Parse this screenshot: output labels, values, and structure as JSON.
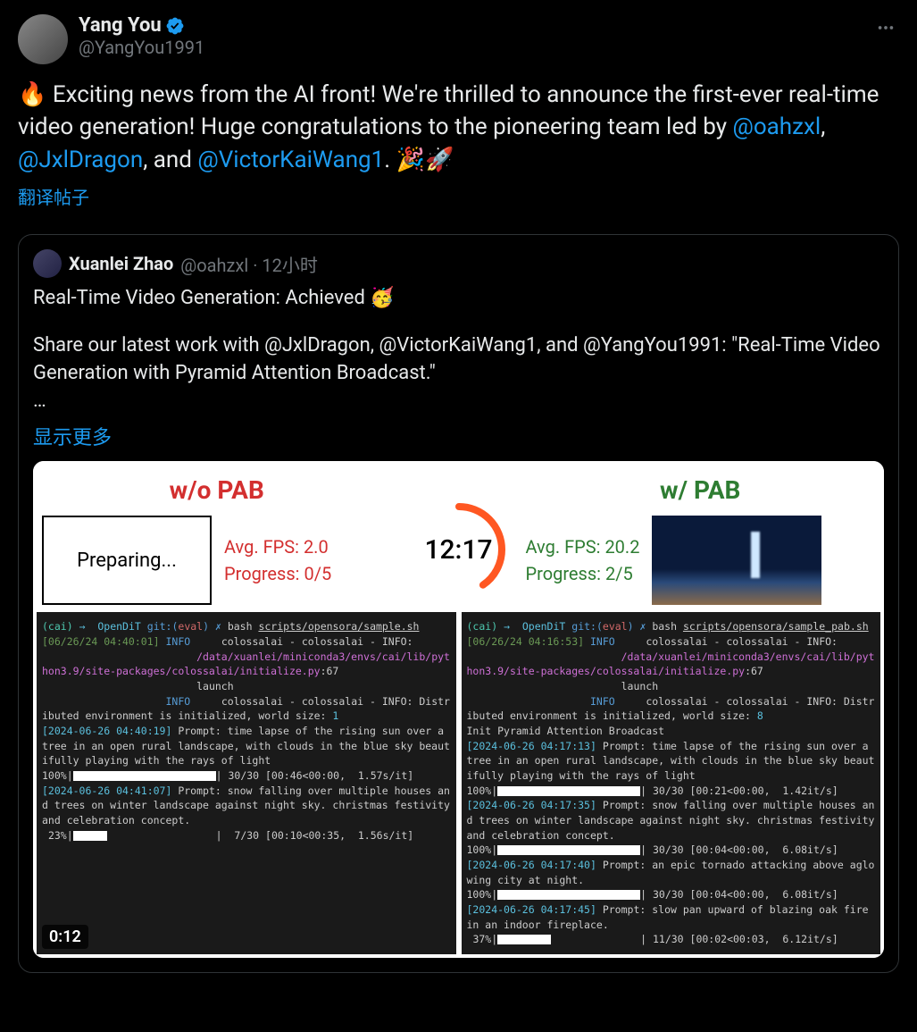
{
  "author": {
    "display_name": "Yang You",
    "handle": "@YangYou1991"
  },
  "tweet": {
    "text_parts": {
      "p1": "🔥 Exciting news from the AI front! We're thrilled to announce the first-ever real-time video generation! Huge congratulations to the pioneering team led by ",
      "m1": "@oahzxl",
      "c1": ", ",
      "m2": "@JxlDragon",
      "c2": ", and ",
      "m3": "@VictorKaiWang1",
      "p2": ". 🎉🚀"
    },
    "translate_label": "翻译帖子"
  },
  "quoted": {
    "display_name": "Xuanlei Zhao",
    "handle": "@oahzxl",
    "time_sep": " · ",
    "time": "12小时",
    "line1": "Real-Time Video Generation: Achieved 🥳",
    "line2a": "Share our latest work with @JxlDragon, @VictorKaiWang1, and @YangYou1991: \"Real-Time Video Generation with Pyramid Attention Broadcast.\"",
    "ellipsis": "…",
    "show_more": "显示更多"
  },
  "media": {
    "left": {
      "title": "w/o PAB",
      "preview_text": "Preparing...",
      "fps_label": "Avg. FPS: ",
      "fps_value": "2.0",
      "progress_label": "Progress: ",
      "progress_value": "0/5"
    },
    "right": {
      "title": "w/ PAB",
      "fps_label": "Avg. FPS: ",
      "fps_value": "20.2",
      "progress_label": "Progress: ",
      "progress_value": "2/5"
    },
    "timer": "12:17",
    "video_timestamp": "0:12"
  },
  "term_left": {
    "prompt_env": "(cai)",
    "arrow": "→",
    "dir": "OpenDiT",
    "git": "git:(",
    "branch": "eval",
    "gitend": ") ✗",
    "cmd": "bash",
    "script": "scripts/opensora/sample.sh",
    "ts1": "[06/26/24 04:40:01]",
    "info": "INFO",
    "line1": "colossalai - colossalai - INFO:",
    "path1": "/data/xuanlei/miniconda3/envs/cai/lib/python3.9/site-packages/colossalai/initialize.py",
    "pathnum": ":67",
    "launch": "launch",
    "line2": "colossalai - colossalai - INFO: Distributed environment is initialized, world size: ",
    "ws": "1",
    "ts2": "[2024-06-26 04:40:19]",
    "p1": " Prompt: time lapse of the rising sun over a tree in an open rural landscape, with clouds in the blue sky beautifully playing with the rays of light",
    "prog1a": "100%|",
    "prog1b": "| 30/30 [00:46<00:00,  1.57s/it]",
    "ts3": "[2024-06-26 04:41:07]",
    "p2": " Prompt: snow falling over multiple houses and trees on winter landscape against night sky. christmas festivity and celebration concept.",
    "prog2a": " 23%|",
    "prog2b": "|  7/30 [00:10<00:35,  1.56s/it]"
  },
  "term_right": {
    "script": "scripts/opensora/sample_pab.sh",
    "ts1": "[06/26/24 04:16:53]",
    "ws": "8",
    "init": "Init Pyramid Attention Broadcast",
    "ts2": "[2024-06-26 04:17:13]",
    "prog1b": "| 30/30 [00:21<00:00,  1.42it/s]",
    "ts3": "[2024-06-26 04:17:35]",
    "prog2b": "| 30/30 [00:04<00:00,  6.08it/s]",
    "ts4": "[2024-06-26 04:17:40]",
    "p3": " Prompt: an epic tornado attacking above aglowing city at night.",
    "prog3b": "| 30/30 [00:04<00:00,  6.08it/s]",
    "ts5": "[2024-06-26 04:17:45]",
    "p4": " Prompt: slow pan upward of blazing oak fire in an indoor fireplace.",
    "prog4a": " 37%|",
    "prog4b": "| 11/30 [00:02<00:03,  6.12it/s]"
  }
}
